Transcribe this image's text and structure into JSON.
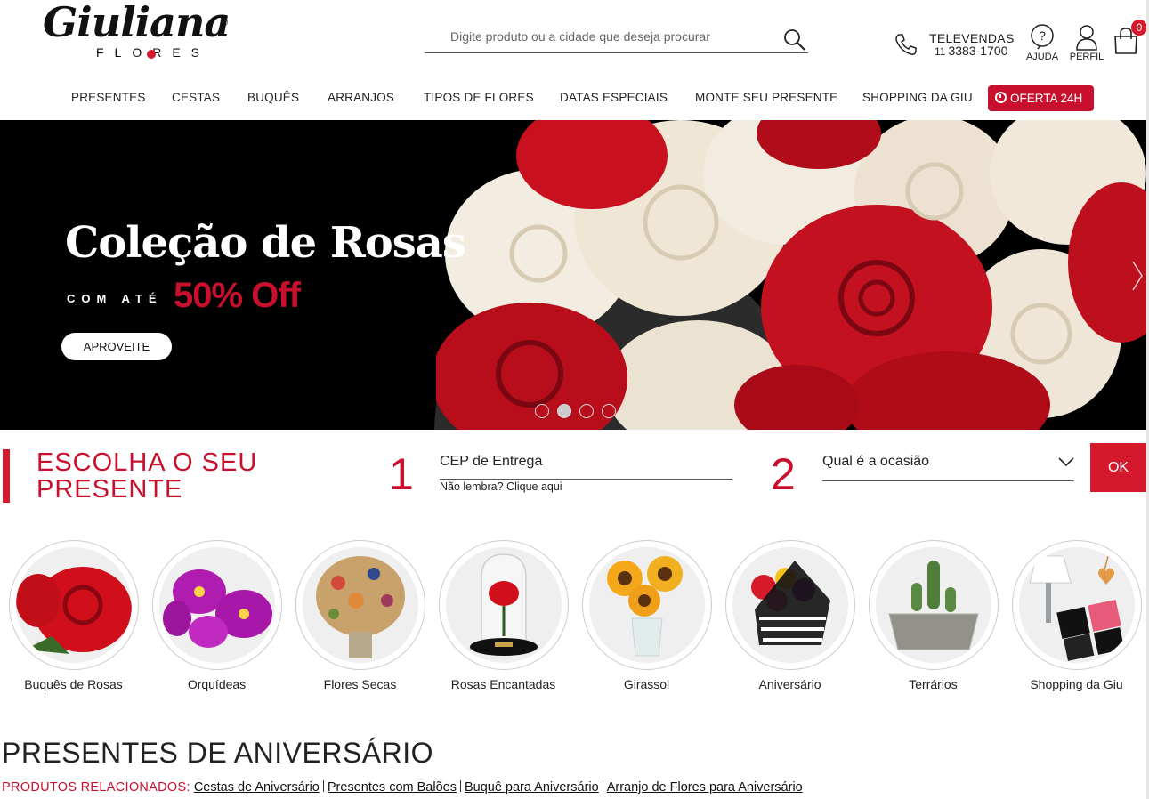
{
  "header": {
    "logo_script": "Giuliana",
    "logo_reg": "®",
    "logo_flores": "FLORES",
    "search_placeholder": "Digite produto ou a cidade que deseja procurar",
    "televendas_label": "TELEVENDAS",
    "televendas_ddd": "11",
    "televendas_number": "3383-1700",
    "help_label": "AJUDA",
    "profile_label": "PERFIL",
    "cart_count": "0"
  },
  "nav": {
    "items": [
      "PRESENTES",
      "CESTAS",
      "BUQUÊS",
      "ARRANJOS",
      "TIPOS DE FLORES",
      "DATAS ESPECIAIS",
      "MONTE SEU PRESENTE",
      "SHOPPING DA GIU"
    ],
    "offer_label": "OFERTA 24H"
  },
  "banner": {
    "title": "Coleção de Rosas",
    "subtitle": "COM ATÉ",
    "discount": "50% Off",
    "cta": "APROVEITE",
    "slide_count": 4,
    "active_slide": 2
  },
  "escolha": {
    "title": "ESCOLHA O SEU PRESENTE",
    "step1": "1",
    "cep_label": "CEP de Entrega",
    "cep_help": "Não lembra? Clique aqui",
    "step2": "2",
    "occasion_label": "Qual é a ocasião",
    "ok_label": "OK"
  },
  "categories": [
    {
      "label": "Buquês de Rosas"
    },
    {
      "label": "Orquídeas"
    },
    {
      "label": "Flores Secas"
    },
    {
      "label": "Rosas Encantadas"
    },
    {
      "label": "Girassol"
    },
    {
      "label": "Aniversário"
    },
    {
      "label": "Terrários"
    },
    {
      "label": "Shopping da Giu"
    }
  ],
  "section": {
    "title": "PRESENTES DE ANIVERSÁRIO",
    "related_label": "PRODUTOS RELACIONADOS:",
    "related_links": [
      "Cestas de Aniversário",
      "Presentes com Balões",
      "Buquê para Aniversário",
      "Arranjo de Flores para Aniversário"
    ]
  },
  "colors": {
    "brand_red": "#c8102e",
    "banner_bg": "#000000"
  }
}
